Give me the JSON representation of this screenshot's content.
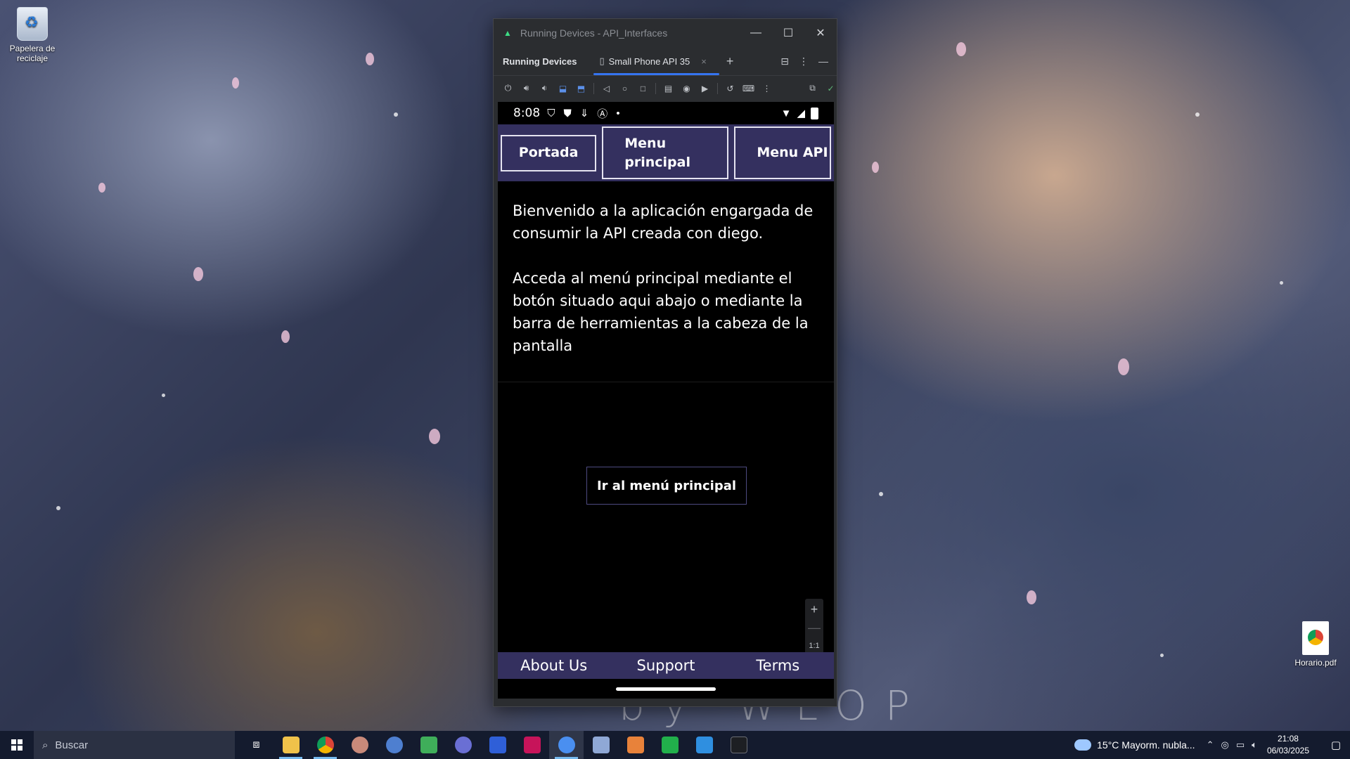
{
  "desktop": {
    "icons": [
      {
        "label": "Papelera de reciclaje",
        "icon": "recycle-bin-icon"
      },
      {
        "label": "Horario.pdf",
        "icon": "chrome-pdf-icon"
      }
    ],
    "wallpaper_signature": "by WLOP"
  },
  "window": {
    "title": "Running Devices - API_Interfaces",
    "tool_window_title": "Running Devices",
    "device_tab": "Small Phone API 35",
    "tab_close": "×",
    "add_tab": "+",
    "controls": {
      "minimize": "—",
      "maximize": "☐",
      "close": "✕"
    }
  },
  "phone": {
    "status": {
      "time": "8:08"
    },
    "nav": {
      "portada": "Portada",
      "menu_principal": "Menu principal",
      "menu_api": "Menu API"
    },
    "welcome_paragraph_1": "Bienvenido a la aplicación engargada de consumir la API creada con diego.",
    "welcome_paragraph_2": "Acceda al menú principal mediante el botón situado aqui abajo o mediante la barra de herramientas a la cabeza de la pantalla",
    "cta_button": "Ir al menú principal",
    "footer": {
      "about": "About Us",
      "support": "Support",
      "terms": "Terms"
    },
    "zoom": {
      "plus": "+",
      "minus": "—",
      "actual": "1:1"
    }
  },
  "taskbar": {
    "search_placeholder": "Buscar",
    "weather": "15°C  Mayorm. nubla...",
    "time": "21:08",
    "date": "06/03/2025"
  },
  "colors": {
    "app_bar": "#34305f",
    "studio_bg": "#2b2d30",
    "tab_accent": "#3574f0",
    "taskbar": "#141b2e"
  }
}
